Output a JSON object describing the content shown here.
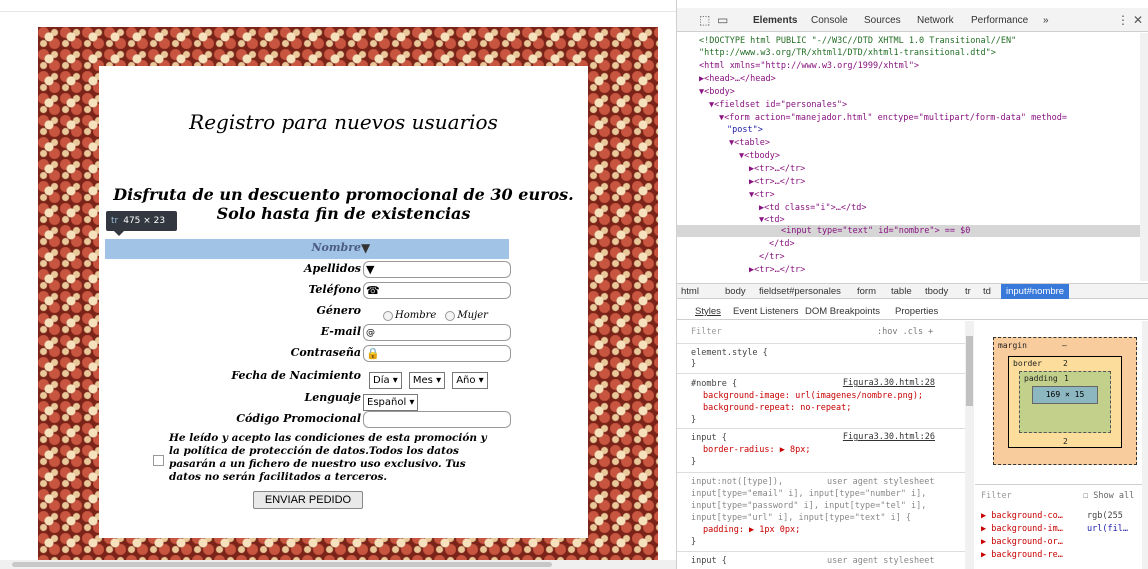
{
  "form": {
    "title": "Registro para nuevos usuarios",
    "promo_line1": "Disfruta de un descuento promocional de 30 euros.",
    "promo_line2": "Solo hasta fin de existencias",
    "fields": {
      "nombre": "Nombre",
      "apellidos": "Apellidos",
      "telefono": "Teléfono",
      "genero": "Género",
      "email": "E-mail",
      "contrasena": "Contraseña",
      "fecha": "Fecha de Nacimiento",
      "lenguaje": "Lenguaje",
      "codigo": "Código Promocional"
    },
    "radio_hombre": "Hombre",
    "radio_mujer": "Mujer",
    "day_select": "Día",
    "month_select": "Mes",
    "year_select": "Año",
    "language_select": "Español",
    "email_icon_text": "@",
    "legal_text": "He leído y acepto las condiciones de esta promoción y la política de protección de datos.Todos los datos pasarán a un fichero de nuestro uso exclusivo. Tus datos no serán facilitados a terceros.",
    "submit_label": "ENVIAR PEDIDO"
  },
  "inspector_tooltip": {
    "tag": "tr",
    "size": "475 × 23"
  },
  "devtools": {
    "tabs": [
      "Elements",
      "Console",
      "Sources",
      "Network",
      "Performance",
      "»"
    ],
    "dom_lines": [
      "<!DOCTYPE html PUBLIC \"-//W3C//DTD XHTML 1.0 Transitional//EN\"",
      "\"http://www.w3.org/TR/xhtml1/DTD/xhtml1-transitional.dtd\">",
      "<html xmlns=\"http://www.w3.org/1999/xhtml\">",
      "▶<head>…</head>",
      "▼<body>",
      "▼<fieldset id=\"personales\">",
      "▼<form action=\"manejador.html\" enctype=\"multipart/form-data\" method=",
      "\"post\">",
      "▼<table>",
      "▼<tbody>",
      "▶<tr>…</tr>",
      "▶<tr>…</tr>",
      "▼<tr>",
      "▶<td class=\"i\">…</td>",
      "▼<td>",
      "<input type=\"text\" id=\"nombre\"> == $0",
      "</td>",
      "</tr>",
      "▶<tr>…</tr>"
    ],
    "breadcrumbs": [
      "html",
      "body",
      "fieldset#personales",
      "form",
      "table",
      "tbody",
      "tr",
      "td",
      "input#nombre"
    ],
    "subtabs": [
      "Styles",
      "Event Listeners",
      "DOM Breakpoints",
      "Properties"
    ],
    "filter_placeholder": "Filter",
    "filter_hov": ":hov .cls +",
    "styles": {
      "element_style": "element.style {",
      "rule1_selector": "#nombre {",
      "rule1_source": "Figura3.30.html:28",
      "rule1_p1": "background-image: url(imagenes/nombre.png);",
      "rule1_p2": "background-repeat: no-repeat;",
      "rule2_selector": "input {",
      "rule2_source": "Figura3.30.html:26",
      "rule2_p1": "border-radius: ▶ 8px;",
      "ua_selector1": "input:not([type]),",
      "ua_label": "user agent stylesheet",
      "ua_selector2": "input[type=\"email\" i], input[type=\"number\" i],",
      "ua_selector3": "input[type=\"password\" i], input[type=\"tel\" i],",
      "ua_selector4": "input[type=\"url\" i], input[type=\"text\" i] {",
      "ua_p1": "padding: ▶ 1px 0px;",
      "ua_next": "input {",
      "ua_label2": "user agent stylesheet"
    },
    "boxmodel": {
      "margin": "margin",
      "border": "border",
      "padding": "padding",
      "content": "169 × 15",
      "margin_value": "–",
      "border_value": "2",
      "padding_value": "1"
    },
    "computed": {
      "filter": "Filter",
      "show_all": "Show all",
      "items": [
        "▶ background-co…",
        "▶ background-im…",
        "▶ background-or…",
        "▶ background-re…"
      ],
      "value1": "rgb(255",
      "value2": "url(fil…"
    }
  }
}
